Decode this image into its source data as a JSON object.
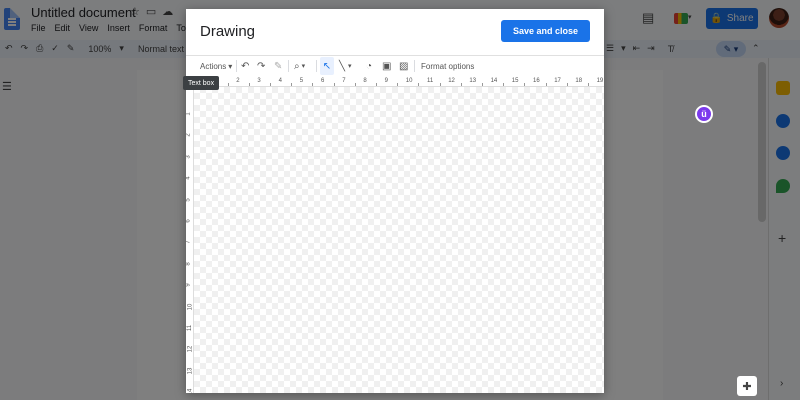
{
  "docs": {
    "title": "Untitled document",
    "menu": [
      "File",
      "Edit",
      "View",
      "Insert",
      "Format",
      "Tools"
    ],
    "toolbar": {
      "zoom": "100%",
      "style": "Normal text"
    },
    "share_label": "Share"
  },
  "dialog": {
    "title": "Drawing",
    "save_label": "Save and close",
    "actions_label": "Actions",
    "format_options_label": "Format options",
    "tooltip": "Text box",
    "ruler_h": [
      "1",
      "2",
      "3",
      "4",
      "5",
      "6",
      "7",
      "8",
      "9",
      "10",
      "11",
      "12",
      "13",
      "14",
      "15",
      "16",
      "17",
      "18",
      "19"
    ],
    "ruler_v": [
      "1",
      "2",
      "3",
      "4",
      "5",
      "6",
      "7",
      "8",
      "9",
      "10",
      "11",
      "12",
      "13",
      "14"
    ]
  },
  "colors": {
    "accent": "#1a73e8",
    "scrim": "#7d7d7d"
  }
}
